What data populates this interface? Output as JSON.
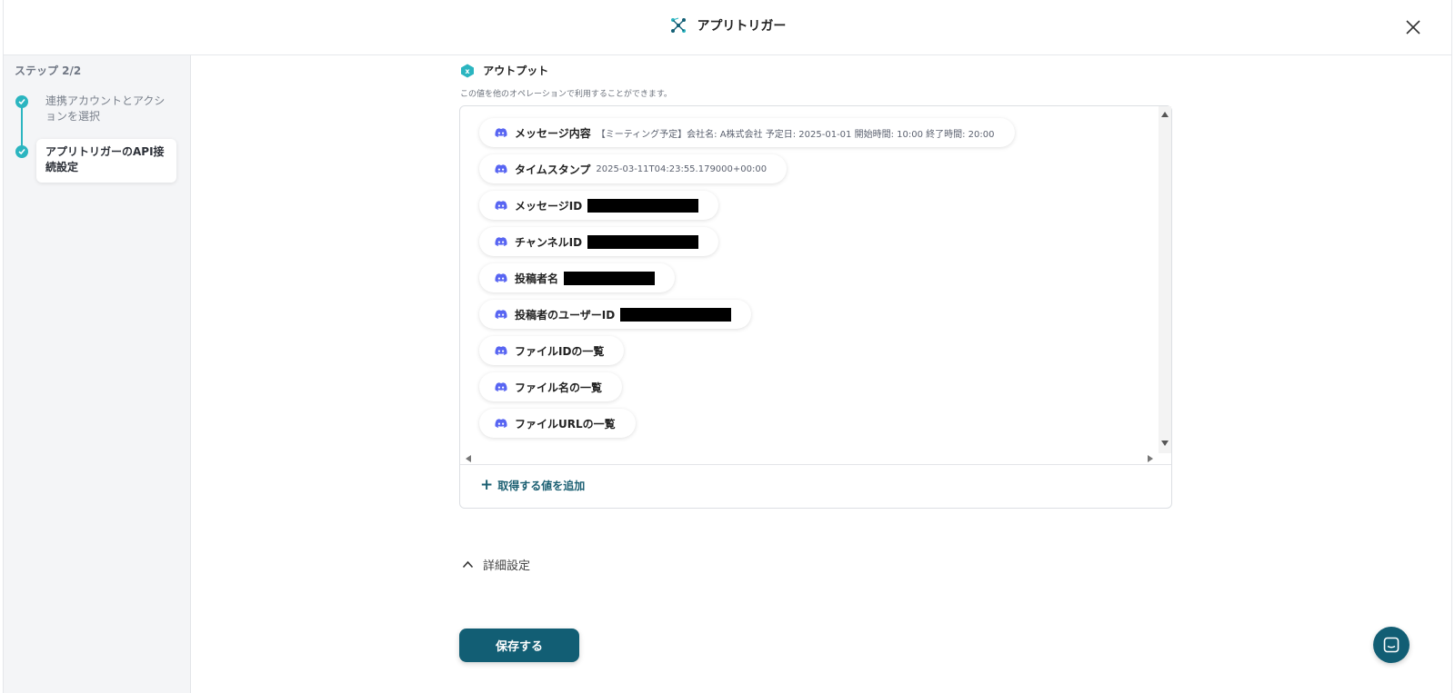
{
  "header": {
    "title": "アプリトリガー",
    "logo_icon": "app-trigger-logo-icon",
    "close_icon": "close-icon"
  },
  "sidebar": {
    "step_label": "ステップ 2/2",
    "steps": [
      {
        "label": "連携アカウントとアクションを選択",
        "status": "completed"
      },
      {
        "label": "アプリトリガーのAPI接続設定",
        "status": "current"
      }
    ]
  },
  "output": {
    "title": "アウトプット",
    "description": "この値を他のオペレーションで利用することができます。",
    "items": [
      {
        "label": "メッセージ内容",
        "value": "【ミーティング予定】会社名: A株式会社 予定日: 2025-01-01 開始時間: 10:00 終了時間: 20:00"
      },
      {
        "label": "タイムスタンプ",
        "value": "2025-03-11T04:23:55.179000+00:00"
      },
      {
        "label": "メッセージID",
        "value": "",
        "redacted": true
      },
      {
        "label": "チャンネルID",
        "value": "",
        "redacted": true
      },
      {
        "label": "投稿者名",
        "value": "",
        "redacted": true
      },
      {
        "label": "投稿者のユーザーID",
        "value": "",
        "redacted": true
      },
      {
        "label": "ファイルIDの一覧",
        "value": ""
      },
      {
        "label": "ファイル名の一覧",
        "value": ""
      },
      {
        "label": "ファイルURLの一覧",
        "value": ""
      }
    ],
    "add_value_label": "取得する値を追加"
  },
  "advanced": {
    "label": "詳細設定",
    "expanded": true
  },
  "save_label": "保存する",
  "colors": {
    "accent": "#2bb5c0",
    "primary": "#125e74",
    "discord": "#5865f2"
  }
}
